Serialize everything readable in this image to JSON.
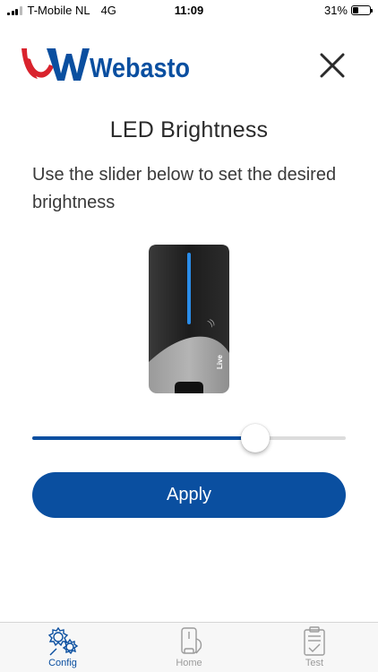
{
  "status_bar": {
    "carrier": "T-Mobile NL",
    "network": "4G",
    "time": "11:09",
    "battery_percent": "31%",
    "battery_level": 0.31
  },
  "header": {
    "logo_text": "Webasto",
    "close_icon": "close-icon"
  },
  "page": {
    "title": "LED Brightness",
    "description": "Use the slider below to set the desired brightness"
  },
  "device_image": {
    "label": "Live"
  },
  "slider": {
    "value_fraction": 0.71
  },
  "apply_label": "Apply",
  "tabs": [
    {
      "label": "Config",
      "icon": "gears-icon",
      "active": true
    },
    {
      "label": "Home",
      "icon": "charger-home-icon",
      "active": false
    },
    {
      "label": "Test",
      "icon": "clipboard-check-icon",
      "active": false
    }
  ],
  "colors": {
    "brand_blue": "#0a4fa0",
    "logo_red": "#d9232d",
    "tab_inactive": "#9b9b9b"
  }
}
